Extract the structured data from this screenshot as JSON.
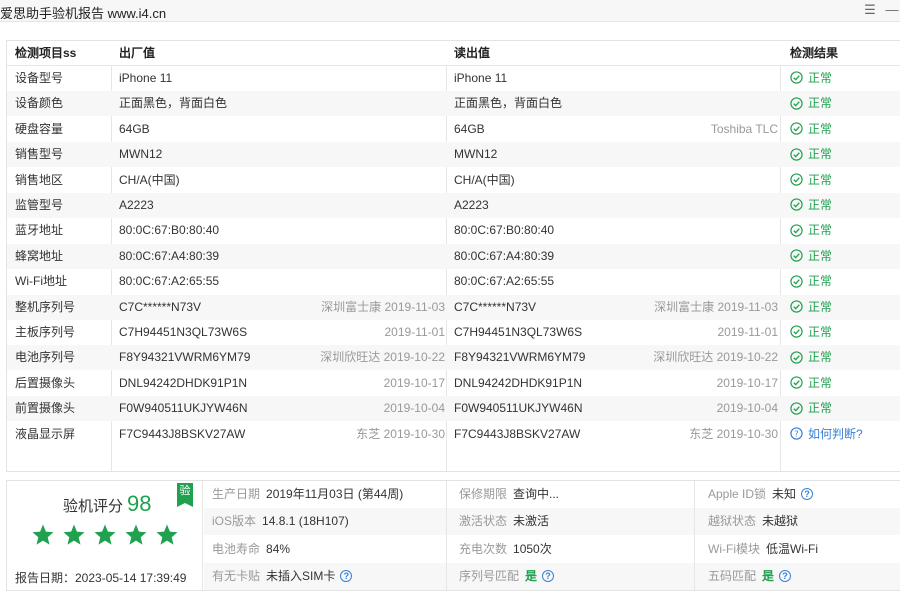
{
  "window": {
    "title": "爱思助手验机报告 www.i4.cn"
  },
  "table": {
    "headers": {
      "item": "检测项目ss",
      "factory": "出厂值",
      "read": "读出值",
      "result": "检测结果"
    },
    "rows": [
      {
        "item": "设备型号",
        "factory": "iPhone 11",
        "factory_extra": "",
        "read": "iPhone 11",
        "read_extra": "",
        "result": "正常",
        "status": "ok"
      },
      {
        "item": "设备颜色",
        "factory": "正面黑色，背面白色",
        "factory_extra": "",
        "read": "正面黑色，背面白色",
        "read_extra": "",
        "result": "正常",
        "status": "ok"
      },
      {
        "item": "硬盘容量",
        "factory": "64GB",
        "factory_extra": "",
        "read": "64GB",
        "read_extra": "Toshiba TLC",
        "result": "正常",
        "status": "ok"
      },
      {
        "item": "销售型号",
        "factory": "MWN12",
        "factory_extra": "",
        "read": "MWN12",
        "read_extra": "",
        "result": "正常",
        "status": "ok"
      },
      {
        "item": "销售地区",
        "factory": "CH/A(中国)",
        "factory_extra": "",
        "read": "CH/A(中国)",
        "read_extra": "",
        "result": "正常",
        "status": "ok"
      },
      {
        "item": "监管型号",
        "factory": "A2223",
        "factory_extra": "",
        "read": "A2223",
        "read_extra": "",
        "result": "正常",
        "status": "ok"
      },
      {
        "item": "蓝牙地址",
        "factory": "80:0C:67:B0:80:40",
        "factory_extra": "",
        "read": "80:0C:67:B0:80:40",
        "read_extra": "",
        "result": "正常",
        "status": "ok"
      },
      {
        "item": "蜂窝地址",
        "factory": "80:0C:67:A4:80:39",
        "factory_extra": "",
        "read": "80:0C:67:A4:80:39",
        "read_extra": "",
        "result": "正常",
        "status": "ok"
      },
      {
        "item": "Wi-Fi地址",
        "factory": "80:0C:67:A2:65:55",
        "factory_extra": "",
        "read": "80:0C:67:A2:65:55",
        "read_extra": "",
        "result": "正常",
        "status": "ok"
      },
      {
        "item": "整机序列号",
        "factory": "C7C******N73V",
        "factory_extra": "深圳富士康 2019-11-03",
        "read": "C7C******N73V",
        "read_extra": "深圳富士康 2019-11-03",
        "result": "正常",
        "status": "ok"
      },
      {
        "item": "主板序列号",
        "factory": "C7H94451N3QL73W6S",
        "factory_extra": "2019-11-01",
        "read": "C7H94451N3QL73W6S",
        "read_extra": "2019-11-01",
        "result": "正常",
        "status": "ok"
      },
      {
        "item": "电池序列号",
        "factory": "F8Y94321VWRM6YM79",
        "factory_extra": "深圳欣旺达 2019-10-22",
        "read": "F8Y94321VWRM6YM79",
        "read_extra": "深圳欣旺达 2019-10-22",
        "result": "正常",
        "status": "ok"
      },
      {
        "item": "后置摄像头",
        "factory": "DNL94242DHDK91P1N",
        "factory_extra": "2019-10-17",
        "read": "DNL94242DHDK91P1N",
        "read_extra": "2019-10-17",
        "result": "正常",
        "status": "ok"
      },
      {
        "item": "前置摄像头",
        "factory": "F0W940511UKJYW46N",
        "factory_extra": "2019-10-04",
        "read": "F0W940511UKJYW46N",
        "read_extra": "2019-10-04",
        "result": "正常",
        "status": "ok"
      },
      {
        "item": "液晶显示屏",
        "factory": "F7C9443J8BSKV27AW",
        "factory_extra": "东芝 2019-10-30",
        "read": "F7C9443J8BSKV27AW",
        "read_extra": "东芝 2019-10-30",
        "result": "如何判断?",
        "status": "question"
      }
    ]
  },
  "summary": {
    "score_label": "验机评分",
    "score": "98",
    "badge": "验",
    "stars": 5,
    "report_date": "报告日期：2023-05-14 17:39:49",
    "info": [
      [
        {
          "label": "生产日期",
          "value": "2019年11月03日 (第44周)",
          "help": false,
          "green": false
        },
        {
          "label": "保修期限",
          "value": "查询中...",
          "help": false,
          "green": false
        },
        {
          "label": "Apple ID锁",
          "value": "未知",
          "help": true,
          "green": false
        }
      ],
      [
        {
          "label": "iOS版本",
          "value": "14.8.1 (18H107)",
          "help": false,
          "green": false
        },
        {
          "label": "激活状态",
          "value": "未激活",
          "help": false,
          "green": false
        },
        {
          "label": "越狱状态",
          "value": "未越狱",
          "help": false,
          "green": false
        }
      ],
      [
        {
          "label": "电池寿命",
          "value": "84%",
          "help": false,
          "green": false
        },
        {
          "label": "充电次数",
          "value": "1050次",
          "help": false,
          "green": false
        },
        {
          "label": "Wi-Fi模块",
          "value": "低温Wi-Fi",
          "help": false,
          "green": false
        }
      ],
      [
        {
          "label": "有无卡贴",
          "value": "未插入SIM卡",
          "help": true,
          "green": false
        },
        {
          "label": "序列号匹配",
          "value": "是",
          "help": true,
          "green": true
        },
        {
          "label": "五码匹配",
          "value": "是",
          "help": true,
          "green": true
        }
      ]
    ]
  },
  "colors": {
    "ok": "#20a150",
    "link": "#3a7fd5",
    "alt_row": "#f7f7f7"
  },
  "icons": {
    "menu": "menu-icon",
    "minimize": "minimize-icon",
    "ok": "check-circle-icon",
    "question": "question-circle-icon",
    "star": "star-icon"
  }
}
